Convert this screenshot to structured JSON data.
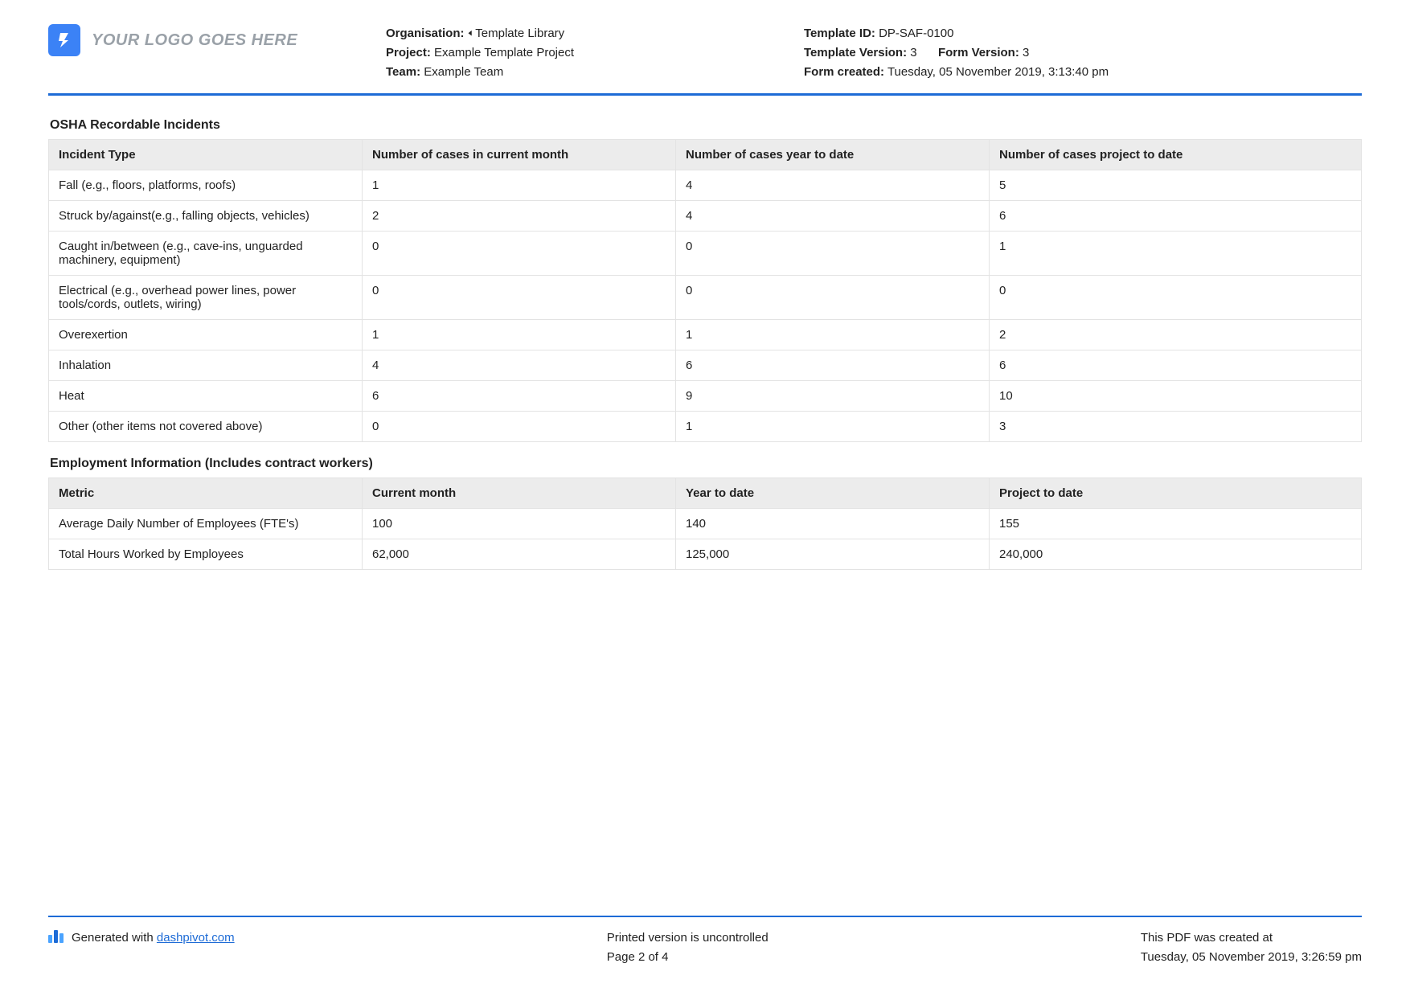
{
  "header": {
    "logo_text": "YOUR LOGO GOES HERE",
    "organisation_label": "Organisation:",
    "organisation_value": "🢐 Template Library",
    "project_label": "Project:",
    "project_value": "Example Template Project",
    "team_label": "Team:",
    "team_value": "Example Team",
    "template_id_label": "Template ID:",
    "template_id_value": "DP-SAF-0100",
    "template_version_label": "Template Version:",
    "template_version_value": "3",
    "form_version_label": "Form Version:",
    "form_version_value": "3",
    "form_created_label": "Form created:",
    "form_created_value": "Tuesday, 05 November 2019, 3:13:40 pm"
  },
  "section1": {
    "title": "OSHA Recordable Incidents",
    "columns": [
      "Incident Type",
      "Number of cases in current month",
      "Number of cases year to date",
      "Number of cases project to date"
    ],
    "rows": [
      {
        "type": "Fall (e.g., floors, platforms, roofs)",
        "month": "1",
        "ytd": "4",
        "ptd": "5"
      },
      {
        "type": "Struck by/against(e.g., falling objects, vehicles)",
        "month": "2",
        "ytd": "4",
        "ptd": "6"
      },
      {
        "type": "Caught in/between (e.g., cave-ins, unguarded machinery, equipment)",
        "month": "0",
        "ytd": "0",
        "ptd": "1"
      },
      {
        "type": "Electrical (e.g., overhead power lines, power tools/cords, outlets, wiring)",
        "month": "0",
        "ytd": "0",
        "ptd": "0"
      },
      {
        "type": "Overexertion",
        "month": "1",
        "ytd": "1",
        "ptd": "2"
      },
      {
        "type": "Inhalation",
        "month": "4",
        "ytd": "6",
        "ptd": "6"
      },
      {
        "type": "Heat",
        "month": "6",
        "ytd": "9",
        "ptd": "10"
      },
      {
        "type": "Other (other items not covered above)",
        "month": "0",
        "ytd": "1",
        "ptd": "3"
      }
    ]
  },
  "section2": {
    "title": "Employment Information (Includes contract workers)",
    "columns": [
      "Metric",
      "Current month",
      "Year to date",
      "Project to date"
    ],
    "rows": [
      {
        "metric": "Average Daily Number of Employees (FTE's)",
        "month": "100",
        "ytd": "140",
        "ptd": "155"
      },
      {
        "metric": "Total Hours Worked by Employees",
        "month": "62,000",
        "ytd": "125,000",
        "ptd": "240,000"
      }
    ]
  },
  "footer": {
    "generated_prefix": "Generated with ",
    "generated_link": "dashpivot.com",
    "uncontrolled": "Printed version is uncontrolled",
    "page": "Page 2 of 4",
    "created_label": "This PDF was created at",
    "created_value": "Tuesday, 05 November 2019, 3:26:59 pm"
  }
}
